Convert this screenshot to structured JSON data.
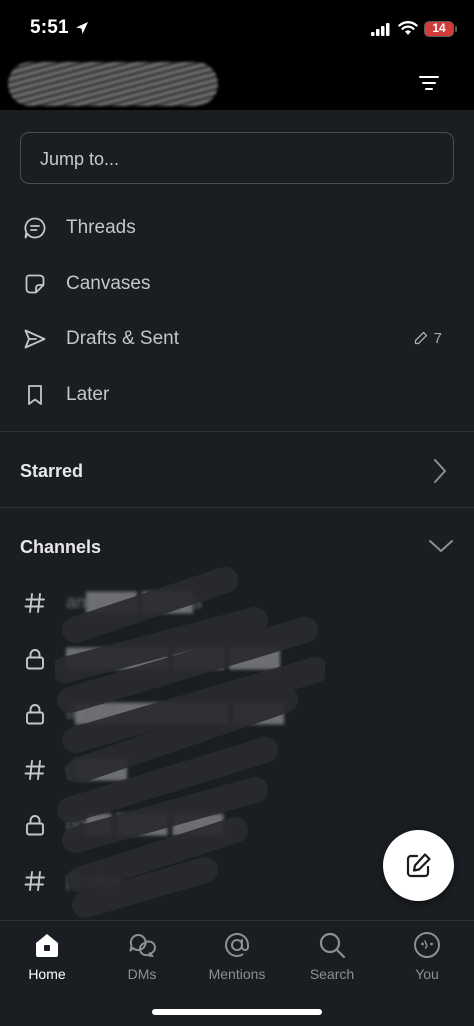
{
  "status_bar": {
    "time": "5:51",
    "battery": "14"
  },
  "header": {
    "filter_icon": "filter-lines-icon"
  },
  "jump": {
    "placeholder": "Jump to..."
  },
  "nav": [
    {
      "label": "Threads",
      "icon": "threads-icon"
    },
    {
      "label": "Canvases",
      "icon": "canvas-icon"
    },
    {
      "label": "Drafts & Sent",
      "icon": "send-icon",
      "count": "7"
    },
    {
      "label": "Later",
      "icon": "bookmark-icon"
    }
  ],
  "sections": {
    "starred": "Starred",
    "channels": "Channels"
  },
  "channels": [
    {
      "type": "public",
      "name": "an████ ████s"
    },
    {
      "type": "private",
      "name": "████████ ████ ████"
    },
    {
      "type": "private",
      "name": "fi████████████ ████"
    },
    {
      "type": "public",
      "name": "g████"
    },
    {
      "type": "private",
      "name": "go██ ████ ████"
    },
    {
      "type": "public",
      "name": "photos"
    }
  ],
  "tabs": [
    {
      "label": "Home",
      "active": true
    },
    {
      "label": "DMs",
      "active": false
    },
    {
      "label": "Mentions",
      "active": false
    },
    {
      "label": "Search",
      "active": false
    },
    {
      "label": "You",
      "active": false
    }
  ],
  "colors": {
    "background": "#1a1d21",
    "header": "#000000",
    "battery": "#d33a3a",
    "fab": "#ffffff"
  }
}
